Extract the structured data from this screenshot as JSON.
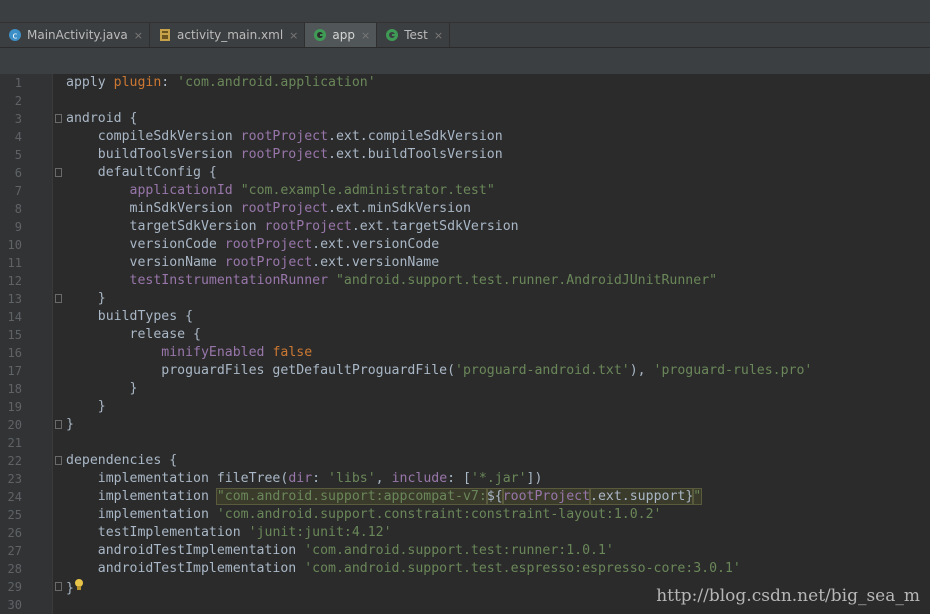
{
  "tabs": [
    {
      "label": "MainActivity.java",
      "icon": "java-class-icon",
      "active": false
    },
    {
      "label": "activity_main.xml",
      "icon": "xml-layout-icon",
      "active": false
    },
    {
      "label": "app",
      "icon": "gradle-module-icon",
      "active": true
    },
    {
      "label": "Test",
      "icon": "gradle-module-icon",
      "active": false
    }
  ],
  "tab_close_glyph": "×",
  "colors": {
    "background": "#2b2b2b",
    "gutter": "#313335",
    "string": "#6a8759",
    "keyword": "#cc7832",
    "property": "#9876aa",
    "default_text": "#a9b7c6",
    "line_number": "#606366"
  },
  "editor": {
    "lines": [
      {
        "num": "1",
        "segs": [
          [
            "def",
            "apply "
          ],
          [
            "kw",
            "plugin"
          ],
          [
            "def",
            ": "
          ],
          [
            "str",
            "'com.android.application'"
          ]
        ]
      },
      {
        "num": "2",
        "segs": []
      },
      {
        "num": "3",
        "segs": [
          [
            "def",
            "android {"
          ]
        ]
      },
      {
        "num": "4",
        "segs": [
          [
            "def",
            "    compileSdkVersion "
          ],
          [
            "prop",
            "rootProject"
          ],
          [
            "def",
            ".ext.compileSdkVersion"
          ]
        ]
      },
      {
        "num": "5",
        "segs": [
          [
            "def",
            "    buildToolsVersion "
          ],
          [
            "prop",
            "rootProject"
          ],
          [
            "def",
            ".ext.buildToolsVersion"
          ]
        ]
      },
      {
        "num": "6",
        "segs": [
          [
            "def",
            "    defaultConfig {"
          ]
        ]
      },
      {
        "num": "7",
        "segs": [
          [
            "def",
            "        "
          ],
          [
            "prop",
            "applicationId "
          ],
          [
            "str",
            "\"com.example.administrator.test\""
          ]
        ]
      },
      {
        "num": "8",
        "segs": [
          [
            "def",
            "        minSdkVersion "
          ],
          [
            "prop",
            "rootProject"
          ],
          [
            "def",
            ".ext.minSdkVersion"
          ]
        ]
      },
      {
        "num": "9",
        "segs": [
          [
            "def",
            "        targetSdkVersion "
          ],
          [
            "prop",
            "rootProject"
          ],
          [
            "def",
            ".ext.targetSdkVersion"
          ]
        ]
      },
      {
        "num": "10",
        "segs": [
          [
            "def",
            "        versionCode "
          ],
          [
            "prop",
            "rootProject"
          ],
          [
            "def",
            ".ext.versionCode"
          ]
        ]
      },
      {
        "num": "11",
        "segs": [
          [
            "def",
            "        versionName "
          ],
          [
            "prop",
            "rootProject"
          ],
          [
            "def",
            ".ext.versionName"
          ]
        ]
      },
      {
        "num": "12",
        "segs": [
          [
            "def",
            "        "
          ],
          [
            "prop",
            "testInstrumentationRunner "
          ],
          [
            "str",
            "\"android.support.test.runner.AndroidJUnitRunner\""
          ]
        ]
      },
      {
        "num": "13",
        "segs": [
          [
            "def",
            "    }"
          ]
        ]
      },
      {
        "num": "14",
        "segs": [
          [
            "def",
            "    buildTypes {"
          ]
        ]
      },
      {
        "num": "15",
        "segs": [
          [
            "def",
            "        release {"
          ]
        ]
      },
      {
        "num": "16",
        "segs": [
          [
            "def",
            "            "
          ],
          [
            "prop",
            "minifyEnabled "
          ],
          [
            "kw",
            "false"
          ]
        ]
      },
      {
        "num": "17",
        "segs": [
          [
            "def",
            "            proguardFiles getDefaultProguardFile("
          ],
          [
            "str",
            "'proguard-android.txt'"
          ],
          [
            "def",
            "), "
          ],
          [
            "str",
            "'proguard-rules.pro'"
          ]
        ]
      },
      {
        "num": "18",
        "segs": [
          [
            "def",
            "        }"
          ]
        ]
      },
      {
        "num": "19",
        "segs": [
          [
            "def",
            "    }"
          ]
        ]
      },
      {
        "num": "20",
        "segs": [
          [
            "def",
            "}"
          ]
        ]
      },
      {
        "num": "21",
        "segs": []
      },
      {
        "num": "22",
        "segs": [
          [
            "def",
            "dependencies {"
          ]
        ]
      },
      {
        "num": "23",
        "segs": [
          [
            "def",
            "    implementation fileTree("
          ],
          [
            "prop",
            "dir"
          ],
          [
            "def",
            ": "
          ],
          [
            "str",
            "'libs'"
          ],
          [
            "def",
            ", "
          ],
          [
            "prop",
            "include"
          ],
          [
            "def",
            ": ["
          ],
          [
            "str",
            "'*.jar'"
          ],
          [
            "def",
            "])"
          ]
        ]
      },
      {
        "num": "24",
        "segs": [
          [
            "def",
            "    implementation "
          ],
          [
            "hlstr",
            "\"com.android.support:appcompat-v7:"
          ],
          [
            "hldef",
            "${"
          ],
          [
            "hlprop",
            "rootProject"
          ],
          [
            "hldef",
            ".ext.support}"
          ],
          [
            "hlstr",
            "\""
          ]
        ]
      },
      {
        "num": "25",
        "segs": [
          [
            "def",
            "    implementation "
          ],
          [
            "str",
            "'com.android.support.constraint:constraint-layout:1.0.2'"
          ]
        ]
      },
      {
        "num": "26",
        "segs": [
          [
            "def",
            "    testImplementation "
          ],
          [
            "str",
            "'junit:junit:4.12'"
          ]
        ]
      },
      {
        "num": "27",
        "segs": [
          [
            "def",
            "    androidTestImplementation "
          ],
          [
            "str",
            "'com.android.support.test:runner:1.0.1'"
          ]
        ]
      },
      {
        "num": "28",
        "segs": [
          [
            "def",
            "    androidTestImplementation "
          ],
          [
            "str",
            "'com.android.support.test.espresso:espresso-core:3.0.1'"
          ]
        ]
      },
      {
        "num": "29",
        "segs": [
          [
            "def",
            "}"
          ]
        ]
      },
      {
        "num": "30",
        "segs": []
      }
    ],
    "fold_lines": [
      "3",
      "6",
      "13",
      "20",
      "22",
      "29"
    ],
    "intention_bulb_line": "29"
  },
  "watermark": "http://blog.csdn.net/big_sea_m"
}
